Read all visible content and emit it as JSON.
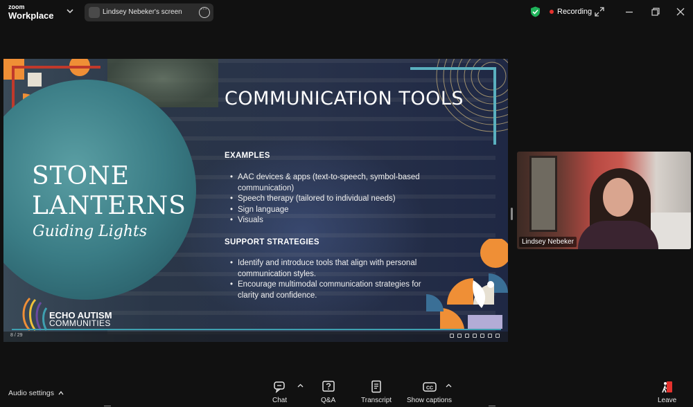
{
  "topbar": {
    "brand_small": "zoom",
    "brand_large": "Workplace",
    "share_label": "Lindsey Nebeker's screen",
    "recording_label": "Recording",
    "recording_color": "#e5322e",
    "shield_color": "#1fb35a"
  },
  "slide": {
    "left_title_line1": "STONE",
    "left_title_line2": "LANTERNS",
    "left_subtitle": "Guiding Lights",
    "title": "COMMUNICATION TOOLS",
    "sections": [
      {
        "heading": "EXAMPLES",
        "items": [
          "AAC devices & apps (text-to-speech, symbol-based communication)",
          "Speech therapy (tailored to individual needs)",
          "Sign language",
          "Visuals"
        ]
      },
      {
        "heading": "SUPPORT STRATEGIES",
        "items": [
          "Identify and introduce tools that align with personal communication styles.",
          "Encourage multimodal communication strategies for clarity and confidence."
        ]
      }
    ],
    "logo_line1": "ECHO AUTISM",
    "logo_line2": "COMMUNITIES",
    "page_indicator": "8 / 29",
    "colors": {
      "accent_orange": "#ef8f36",
      "accent_teal": "#5a9ea3",
      "accent_red": "#c0392b"
    }
  },
  "video": {
    "participant_name": "Lindsey Nebeker"
  },
  "bottombar": {
    "audio_label": "Audio settings",
    "items": [
      {
        "label": "Chat",
        "icon": "chat-icon"
      },
      {
        "label": "Q&A",
        "icon": "qa-icon"
      },
      {
        "label": "Transcript",
        "icon": "transcript-icon"
      },
      {
        "label": "Show captions",
        "icon": "captions-icon"
      },
      {
        "label": "Leave",
        "icon": "leave-icon"
      }
    ]
  }
}
